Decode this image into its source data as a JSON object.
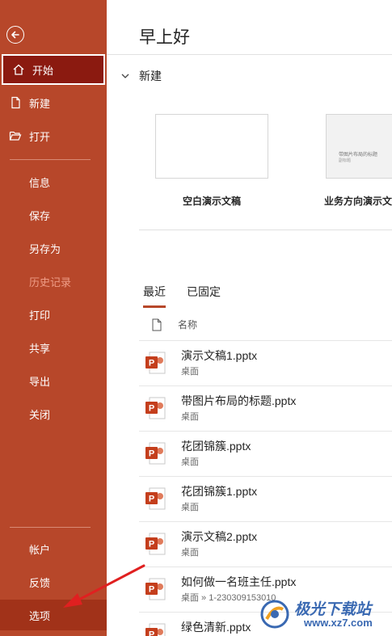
{
  "sidebar": {
    "items": {
      "home": "开始",
      "new": "新建",
      "open": "打开",
      "info": "信息",
      "save": "保存",
      "save_as": "另存为",
      "history": "历史记录",
      "print": "打印",
      "share": "共享",
      "export": "导出",
      "close": "关闭",
      "account": "帐户",
      "feedback": "反馈",
      "options": "选项"
    },
    "icons": [
      "back-arrow-icon",
      "home-icon",
      "new-document-icon",
      "folder-open-icon"
    ],
    "background_color": "#b7472a",
    "active_color": "#8b1a10"
  },
  "main": {
    "greeting": "早上好",
    "new_section": {
      "title": "新建",
      "templates": [
        {
          "label": "空白演示文稿"
        },
        {
          "label": "业务方向演示文",
          "thumb_title": "带图片布局的标题",
          "thumb_sub": "副标题"
        }
      ]
    },
    "tabs": [
      "最近",
      "已固定"
    ],
    "column_header": "名称",
    "files": [
      {
        "name": "演示文稿1.pptx",
        "location": "桌面"
      },
      {
        "name": "带图片布局的标题.pptx",
        "location": "桌面"
      },
      {
        "name": "花团锦簇.pptx",
        "location": "桌面"
      },
      {
        "name": "花团锦簇1.pptx",
        "location": "桌面"
      },
      {
        "name": "演示文稿2.pptx",
        "location": "桌面"
      },
      {
        "name": "如何做一名班主任.pptx",
        "location": "桌面 » 1-230309153010"
      },
      {
        "name": "绿色清新.pptx",
        "location": ""
      }
    ]
  },
  "watermark": {
    "title": "极光下载站",
    "url": "www.xz7.com"
  },
  "accent_color": "#b7472a",
  "annotation_arrow_color": "#e02020"
}
